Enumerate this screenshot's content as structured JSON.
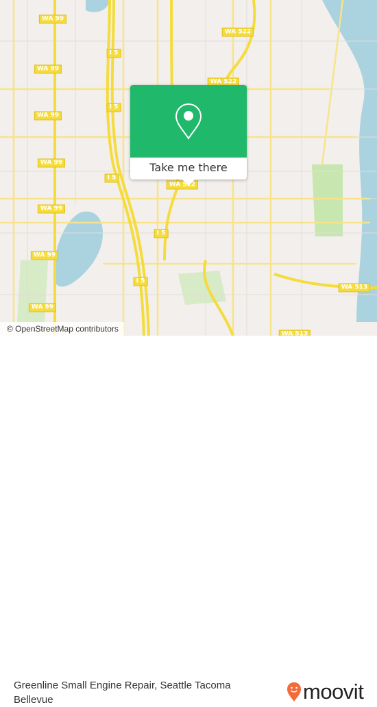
{
  "map": {
    "attribution": "© OpenStreetMap contributors",
    "shields": [
      {
        "label": "WA 99"
      },
      {
        "label": "WA 99"
      },
      {
        "label": "WA 99"
      },
      {
        "label": "WA 99"
      },
      {
        "label": "WA 99"
      },
      {
        "label": "WA 99"
      },
      {
        "label": "WA 99"
      },
      {
        "label": "WA 522"
      },
      {
        "label": "WA 522"
      },
      {
        "label": "WA 522"
      },
      {
        "label": "I 5"
      },
      {
        "label": "I 5"
      },
      {
        "label": "I 5"
      },
      {
        "label": "I 5"
      },
      {
        "label": "I 5"
      },
      {
        "label": "WA 513"
      },
      {
        "label": "WA 513"
      }
    ],
    "colors": {
      "land": "#f2efec",
      "water": "#aad3df",
      "park": "#c8e6b0",
      "highway": "#f5dc3c",
      "accent": "#20b86a"
    }
  },
  "popup": {
    "pin_icon": "map-pin-icon",
    "button_label": "Take me there"
  },
  "footer": {
    "place_title": "Greenline Small Engine Repair, Seattle Tacoma Bellevue",
    "brand": "moovit",
    "brand_color": "#f26b3a"
  }
}
